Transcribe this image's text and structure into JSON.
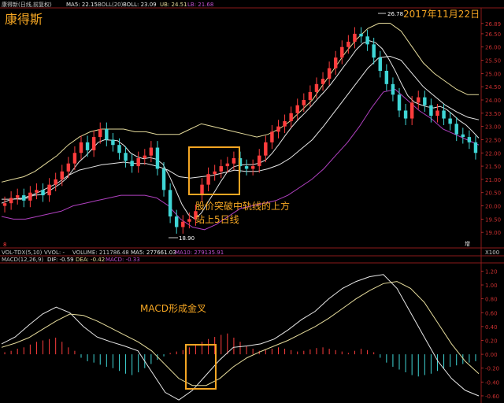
{
  "header": {
    "stock_line": "康得新(日线,前复权)",
    "ma5": "MA5: 22.15",
    "boll_label": "BOLL(20)",
    "boll_value": "BOLL: 23.09",
    "ub": "UB: 24.51",
    "lb": "LB: 21.68"
  },
  "title_big": "康得斯",
  "date_label": "2017年11月22日",
  "high_label": "26.78",
  "low_label": "18.90",
  "annotation_price": [
    "股价突破中轨线的上方",
    "站上5日线"
  ],
  "annotation_macd": "MACD形成金叉",
  "marker_left": "8",
  "marker_right": "增",
  "vol_header": {
    "name": "VOL-TDX(5,10)",
    "vvol": "VVOL: -",
    "volume": "VOLUME: 211786.48",
    "ma5": "MA5: 277661.03",
    "ma10": "MA10: 279135.91",
    "x100": "X100"
  },
  "macd_header": {
    "name": "MACD(12,26,9)",
    "dif": "DIF: -0.59",
    "dea": "DEA: -0.42",
    "macd": "MACD: -0.33"
  },
  "colors": {
    "up": "#ff3d3d",
    "down": "#3fd6d6",
    "boll_band": "#e6dc9c",
    "lb_line": "#b040c0",
    "ma_white": "#e8e8e8",
    "annot": "#f5a623",
    "grid": "#8b1a1a"
  },
  "chart_data": [
    {
      "type": "candlestick",
      "title": "康得斯",
      "y_axis_labels": [
        "26.89",
        "26.50",
        "26.00",
        "25.50",
        "25.00",
        "24.50",
        "24.00",
        "23.50",
        "23.00",
        "22.50",
        "22.00",
        "21.50",
        "21.00",
        "20.50",
        "20.00",
        "19.50",
        "19.00"
      ],
      "ylim": [
        18.5,
        27.3
      ],
      "close": [
        20.1,
        20.3,
        20.4,
        20.2,
        20.5,
        20.6,
        20.4,
        20.8,
        21.0,
        21.3,
        21.6,
        22.0,
        22.4,
        22.1,
        22.6,
        22.9,
        22.5,
        22.3,
        22.0,
        21.7,
        21.5,
        21.8,
        21.9,
        22.2,
        21.4,
        20.6,
        19.6,
        19.2,
        19.4,
        19.5,
        19.8,
        20.8,
        21.2,
        21.3,
        21.5,
        21.6,
        21.8,
        21.5,
        21.4,
        21.5,
        21.9,
        22.4,
        22.8,
        23.0,
        23.2,
        23.5,
        23.8,
        24.0,
        24.3,
        24.6,
        24.8,
        25.2,
        25.6,
        26.0,
        26.2,
        26.5,
        26.4,
        26.1,
        25.6,
        25.1,
        24.6,
        24.2,
        23.6,
        23.3,
        23.9,
        24.1,
        23.8,
        23.4,
        23.6,
        23.3,
        23.1,
        22.7,
        22.6,
        22.4,
        22.0
      ],
      "open": [
        20.0,
        20.1,
        20.3,
        20.4,
        20.2,
        20.5,
        20.6,
        20.4,
        20.8,
        21.0,
        21.3,
        21.6,
        22.0,
        22.4,
        22.1,
        22.6,
        22.9,
        22.5,
        22.3,
        22.0,
        21.7,
        21.5,
        21.8,
        21.9,
        22.2,
        21.4,
        20.6,
        19.6,
        19.2,
        19.4,
        19.5,
        20.4,
        20.8,
        21.2,
        21.3,
        21.5,
        21.6,
        21.8,
        21.5,
        21.4,
        21.5,
        21.9,
        22.4,
        22.8,
        23.0,
        23.2,
        23.5,
        23.8,
        24.0,
        24.3,
        24.6,
        24.8,
        25.2,
        25.6,
        26.0,
        26.2,
        26.5,
        26.4,
        26.1,
        25.6,
        25.1,
        24.6,
        24.2,
        23.6,
        23.3,
        23.9,
        24.1,
        23.8,
        23.4,
        23.6,
        23.3,
        23.1,
        22.7,
        22.6,
        22.4
      ],
      "boll_upper": [
        20.9,
        21.0,
        21.1,
        21.3,
        21.6,
        21.9,
        22.3,
        22.6,
        22.8,
        22.9,
        22.9,
        22.9,
        22.8,
        22.8,
        22.7,
        22.7,
        22.7,
        22.9,
        23.1,
        23.0,
        22.9,
        22.8,
        22.7,
        22.6,
        22.7,
        22.9,
        23.2,
        23.6,
        24.0,
        24.6,
        25.2,
        25.8,
        26.3,
        26.7,
        26.9,
        26.9,
        26.6,
        26.0,
        25.4,
        25.0,
        24.7,
        24.4,
        24.2,
        24.2
      ],
      "boll_lower": [
        19.6,
        19.5,
        19.5,
        19.6,
        19.7,
        19.8,
        20.0,
        20.1,
        20.2,
        20.3,
        20.4,
        20.4,
        20.4,
        20.3,
        20.0,
        19.5,
        19.2,
        19.1,
        19.3,
        19.6,
        19.9,
        20.0,
        20.1,
        20.2,
        20.4,
        20.7,
        21.0,
        21.4,
        21.9,
        22.4,
        23.0,
        23.7,
        24.3,
        24.4,
        24.0,
        23.6,
        23.3,
        22.9,
        22.7,
        22.5,
        22.3
      ]
    },
    {
      "type": "macd",
      "title": "MACD(12,26,9)",
      "y_axis_labels": [
        "1.20",
        "1.00",
        "0.80",
        "0.60",
        "0.40",
        "0.20",
        "0.00",
        "-0.20",
        "-0.40",
        "-0.60"
      ],
      "ylim": [
        -0.68,
        1.25
      ],
      "dif": [
        0.15,
        0.25,
        0.42,
        0.58,
        0.68,
        0.6,
        0.4,
        0.25,
        0.18,
        0.12,
        0.05,
        -0.25,
        -0.55,
        -0.66,
        -0.52,
        -0.3,
        -0.08,
        0.1,
        0.12,
        0.15,
        0.22,
        0.35,
        0.5,
        0.62,
        0.8,
        0.95,
        1.05,
        1.12,
        1.15,
        0.95,
        0.6,
        0.25,
        -0.1,
        -0.35,
        -0.52,
        -0.6
      ],
      "dea": [
        0.1,
        0.16,
        0.24,
        0.36,
        0.48,
        0.58,
        0.56,
        0.48,
        0.38,
        0.28,
        0.18,
        0.05,
        -0.15,
        -0.35,
        -0.45,
        -0.45,
        -0.35,
        -0.18,
        -0.05,
        0.04,
        0.12,
        0.2,
        0.3,
        0.4,
        0.52,
        0.66,
        0.8,
        0.92,
        1.02,
        1.05,
        0.95,
        0.75,
        0.45,
        0.15,
        -0.1,
        -0.28
      ],
      "hist": [
        0.03,
        0.05,
        0.08,
        0.1,
        0.14,
        0.18,
        0.2,
        0.22,
        0.24,
        0.18,
        0.1,
        0.05,
        -0.05,
        -0.1,
        -0.12,
        -0.15,
        -0.18,
        -0.2,
        -0.24,
        -0.28,
        -0.3,
        -0.26,
        -0.2,
        -0.14,
        -0.08,
        -0.03,
        0.02,
        0.04,
        0.06,
        0.1,
        0.14,
        0.18,
        0.22,
        0.25,
        0.28,
        0.3,
        0.24,
        0.18,
        0.12,
        0.08,
        0.05,
        0.06,
        0.08,
        0.1,
        0.08,
        0.06,
        0.04,
        0.05,
        0.07,
        0.09,
        0.1,
        0.08,
        0.06,
        0.04,
        0.02,
        0.05,
        0.08,
        0.06,
        0.03,
        -0.05,
        -0.12,
        -0.18,
        -0.22,
        -0.26,
        -0.3,
        -0.32,
        -0.3,
        -0.28,
        -0.24,
        -0.2,
        -0.18,
        -0.16,
        -0.14,
        -0.12,
        -0.1
      ]
    }
  ]
}
